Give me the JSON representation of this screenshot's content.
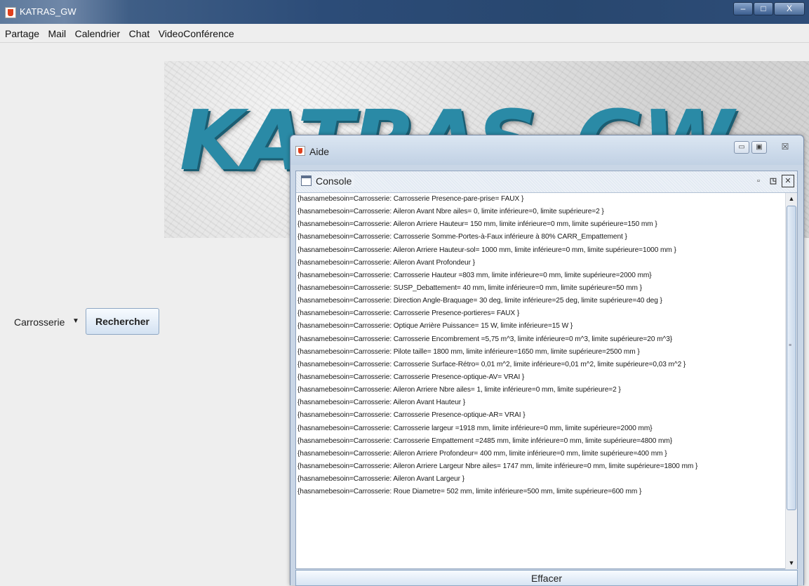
{
  "window": {
    "title": "KATRAS_GW",
    "controls": {
      "minimize": "–",
      "maximize": "□",
      "close": "X"
    }
  },
  "menu": {
    "items": [
      {
        "label": "Partage"
      },
      {
        "label": "Mail"
      },
      {
        "label": "Calendrier"
      },
      {
        "label": "Chat"
      },
      {
        "label": "VideoConférence"
      }
    ]
  },
  "banner": {
    "logo_text": "KATRAS_GW"
  },
  "search": {
    "category_value": "Carrosserie",
    "button_label": "Rechercher"
  },
  "dialog": {
    "title": "Aide",
    "controls": {
      "minimize": "▭",
      "restore": "▣",
      "close": "☒"
    },
    "console": {
      "title": "Console",
      "lines": [
        "{hasnamebesoin=Carrosserie: Carrosserie Presence-pare-prise= FAUX }",
        "{hasnamebesoin=Carrosserie: Aileron Avant Nbre ailes= 0, limite inférieure=0, limite supérieure=2 }",
        "{hasnamebesoin=Carrosserie: Aileron Arriere Hauteur= 150 mm, limite inférieure=0 mm, limite supérieure=150 mm }",
        "{hasnamebesoin=Carrosserie: Carrosserie Somme-Portes-à-Faux inférieure à 80% CARR_Empattement }",
        "{hasnamebesoin=Carrosserie: Aileron Arriere Hauteur-sol= 1000 mm, limite inférieure=0 mm, limite supérieure=1000 mm }",
        "{hasnamebesoin=Carrosserie: Aileron Avant Profondeur }",
        "{hasnamebesoin=Carrosserie: Carrosserie Hauteur =803 mm, limite inférieure=0 mm, limite supérieure=2000 mm}",
        "{hasnamebesoin=Carrosserie: SUSP_Debattement= 40 mm, limite inférieure=0 mm, limite supérieure=50 mm }",
        "{hasnamebesoin=Carrosserie: Direction Angle-Braquage= 30 deg, limite inférieure=25 deg, limite supérieure=40 deg }",
        "{hasnamebesoin=Carrosserie: Carrosserie Presence-portieres= FAUX }",
        "{hasnamebesoin=Carrosserie: Optique Arrière Puissance= 15 W, limite inférieure=15 W }",
        "{hasnamebesoin=Carrosserie: Carrosserie Encombrement =5,75 m^3, limite inférieure=0 m^3, limite supérieure=20 m^3}",
        "{hasnamebesoin=Carrosserie: Pilote taille= 1800 mm, limite inférieure=1650 mm, limite supérieure=2500 mm }",
        "{hasnamebesoin=Carrosserie: Carrosserie Surface-Rétro= 0,01 m^2, limite inférieure=0,01 m^2, limite supérieure=0,03 m^2 }",
        "{hasnamebesoin=Carrosserie: Carrosserie Presence-optique-AV= VRAI }",
        "{hasnamebesoin=Carrosserie: Aileron Arriere Nbre ailes= 1, limite inférieure=0 mm, limite supérieure=2 }",
        "{hasnamebesoin=Carrosserie: Aileron Avant Hauteur }",
        "{hasnamebesoin=Carrosserie: Carrosserie Presence-optique-AR= VRAI }",
        "{hasnamebesoin=Carrosserie: Carrosserie largeur =1918 mm, limite inférieure=0 mm, limite supérieure=2000 mm}",
        "{hasnamebesoin=Carrosserie: Carrosserie Empattement =2485 mm, limite inférieure=0 mm, limite supérieure=4800 mm}",
        "{hasnamebesoin=Carrosserie: Aileron Arriere Profondeur= 400 mm, limite inférieure=0 mm, limite supérieure=400 mm }",
        "{hasnamebesoin=Carrosserie: Aileron Arriere Largeur Nbre ailes= 1747 mm, limite inférieure=0 mm, limite supérieure=1800 mm }",
        "{hasnamebesoin=Carrosserie: Aileron Avant Largeur }",
        "{hasnamebesoin=Carrosserie: Roue Diametre= 502 mm, limite inférieure=500 mm, limite supérieure=600 mm }"
      ]
    },
    "clear_button_label": "Effacer"
  }
}
